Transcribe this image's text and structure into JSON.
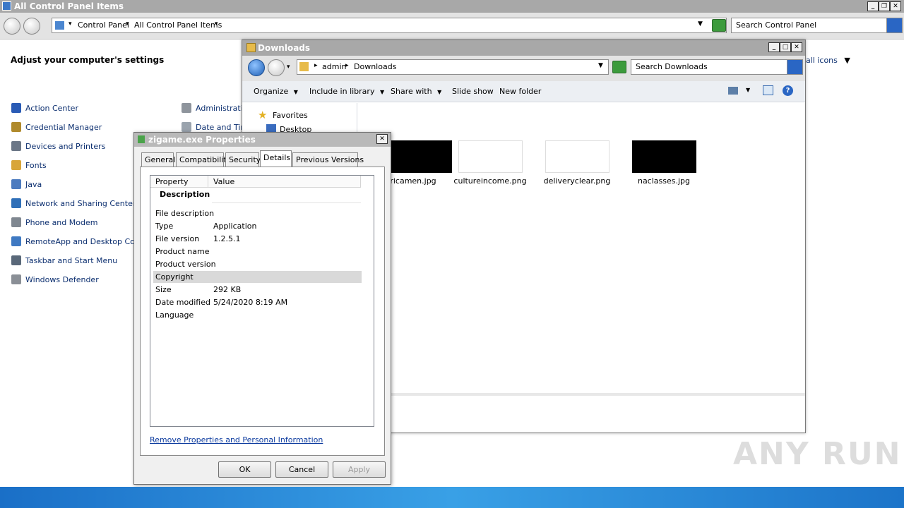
{
  "main_window": {
    "title": "All Control Panel Items",
    "breadcrumb": [
      "Control Panel",
      "All Control Panel Items"
    ],
    "search_placeholder": "Search Control Panel",
    "heading": "Adjust your computer's settings",
    "view_by_value": "all icons",
    "items_col1": [
      {
        "label": "Action Center",
        "icon": "flag-icon",
        "color": "#2a5bb5"
      },
      {
        "label": "Credential Manager",
        "icon": "vault-icon",
        "color": "#b08a2c"
      },
      {
        "label": "Devices and Printers",
        "icon": "printer-icon",
        "color": "#6b7787"
      },
      {
        "label": "Fonts",
        "icon": "fonts-folder-icon",
        "color": "#d8a53a"
      },
      {
        "label": "Java",
        "icon": "java-icon",
        "color": "#4c7bbf"
      },
      {
        "label": "Network and Sharing Center",
        "icon": "network-icon",
        "color": "#2f6fb8"
      },
      {
        "label": "Phone and Modem",
        "icon": "phone-icon",
        "color": "#7f8790"
      },
      {
        "label": "RemoteApp and Desktop Conne",
        "icon": "remoteapp-icon",
        "color": "#3f79c2"
      },
      {
        "label": "Taskbar and Start Menu",
        "icon": "taskbar-icon",
        "color": "#596879"
      },
      {
        "label": "Windows Defender",
        "icon": "defender-icon",
        "color": "#8a8f96"
      }
    ],
    "items_col2": [
      {
        "label": "Administrative",
        "icon": "admin-tools-icon"
      },
      {
        "label": "Date and Time",
        "icon": "clock-icon"
      }
    ]
  },
  "downloads_window": {
    "title": "Downloads",
    "breadcrumb": [
      "admin",
      "Downloads"
    ],
    "search_placeholder": "Search Downloads",
    "toolbar": {
      "organize": "Organize",
      "include_in_library": "Include in library",
      "share_with": "Share with",
      "slide_show": "Slide show",
      "new_folder": "New folder"
    },
    "nav": {
      "favorites": "Favorites",
      "desktop": "Desktop"
    },
    "files": [
      {
        "name": "ricamen.jpg",
        "thumb_color": "#000000"
      },
      {
        "name": "cultureincome.png",
        "thumb_color": "#ffffff"
      },
      {
        "name": "deliveryclear.png",
        "thumb_color": "#ffffff"
      },
      {
        "name": "naclasses.jpg",
        "thumb_color": "#000000"
      }
    ]
  },
  "properties_dialog": {
    "title": "zigame.exe Properties",
    "tabs": [
      "General",
      "Compatibility",
      "Security",
      "Details",
      "Previous Versions"
    ],
    "active_tab": "Details",
    "columns": {
      "property": "Property",
      "value": "Value"
    },
    "section": "Description",
    "rows": [
      {
        "property": "File description",
        "value": ""
      },
      {
        "property": "Type",
        "value": "Application"
      },
      {
        "property": "File version",
        "value": "1.2.5.1"
      },
      {
        "property": "Product name",
        "value": ""
      },
      {
        "property": "Product version",
        "value": ""
      },
      {
        "property": "Copyright",
        "value": ""
      },
      {
        "property": "Size",
        "value": "292 KB"
      },
      {
        "property": "Date modified",
        "value": "5/24/2020 8:19 AM"
      },
      {
        "property": "Language",
        "value": ""
      }
    ],
    "selected_row": "Copyright",
    "remove_link": "Remove Properties and Personal Information",
    "buttons": {
      "ok": "OK",
      "cancel": "Cancel",
      "apply": "Apply"
    }
  },
  "watermark": "ANY RUN"
}
